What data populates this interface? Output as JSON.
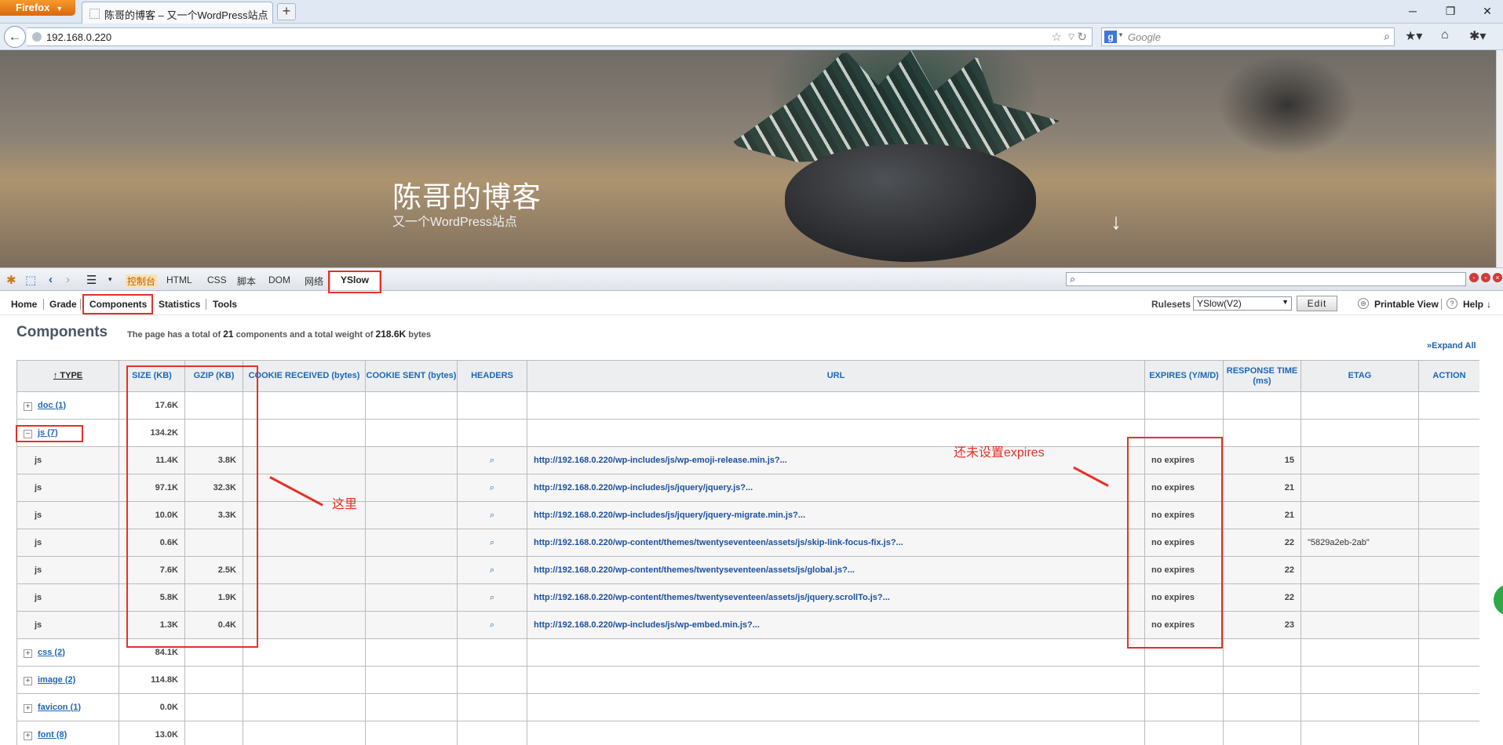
{
  "browser": {
    "app_button": "Firefox",
    "tab_title": "陈哥的博客 – 又一个WordPress站点",
    "address": "192.168.0.220",
    "search_placeholder": "Google"
  },
  "hero": {
    "site_title": "陈哥的博客",
    "site_desc": "又一个WordPress站点"
  },
  "firebug": {
    "tabs": [
      "控制台",
      "HTML",
      "CSS",
      "脚本",
      "DOM",
      "网络"
    ],
    "active_tab": "YSlow"
  },
  "yslow_menu": {
    "items": [
      "Home",
      "Grade",
      "Components",
      "Statistics",
      "Tools"
    ],
    "rulesets_label": "Rulesets",
    "ruleset_value": "YSlow(V2)",
    "edit_label": "Edit",
    "printable_label": "Printable View",
    "help_label": "Help"
  },
  "components": {
    "title": "Components",
    "summary_pre": "The page has a total of",
    "total_count": "21",
    "summary_mid": "components and a total weight of",
    "total_weight": "218.6K",
    "summary_post": "bytes",
    "expand_all": "»Expand All"
  },
  "table": {
    "columns": [
      "↑ TYPE",
      "SIZE (KB)",
      "GZIP (KB)",
      "COOKIE RECEIVED (bytes)",
      "COOKIE SENT (bytes)",
      "HEADERS",
      "URL",
      "EXPIRES (Y/M/D)",
      "RESPONSE TIME (ms)",
      "ETAG",
      "ACTION"
    ],
    "rows": [
      {
        "kind": "group",
        "type": "doc (1)",
        "expanded": false,
        "size": "17.6K"
      },
      {
        "kind": "group",
        "type": "js (7)",
        "expanded": true,
        "size": "134.2K"
      },
      {
        "kind": "item",
        "type": "js",
        "size": "11.4K",
        "gzip": "3.8K",
        "url": "http://192.168.0.220/wp-includes/js/wp-emoji-release.min.js?...",
        "expires": "no expires",
        "time": "15",
        "etag": ""
      },
      {
        "kind": "item",
        "type": "js",
        "size": "97.1K",
        "gzip": "32.3K",
        "url": "http://192.168.0.220/wp-includes/js/jquery/jquery.js?...",
        "expires": "no expires",
        "time": "21",
        "etag": ""
      },
      {
        "kind": "item",
        "type": "js",
        "size": "10.0K",
        "gzip": "3.3K",
        "url": "http://192.168.0.220/wp-includes/js/jquery/jquery-migrate.min.js?...",
        "expires": "no expires",
        "time": "21",
        "etag": ""
      },
      {
        "kind": "item",
        "type": "js",
        "size": "0.6K",
        "gzip": "",
        "url": "http://192.168.0.220/wp-content/themes/twentyseventeen/assets/js/skip-link-focus-fix.js?...",
        "expires": "no expires",
        "time": "22",
        "etag": "\"5829a2eb-2ab\""
      },
      {
        "kind": "item",
        "type": "js",
        "size": "7.6K",
        "gzip": "2.5K",
        "url": "http://192.168.0.220/wp-content/themes/twentyseventeen/assets/js/global.js?...",
        "expires": "no expires",
        "time": "22",
        "etag": ""
      },
      {
        "kind": "item",
        "type": "js",
        "size": "5.8K",
        "gzip": "1.9K",
        "url": "http://192.168.0.220/wp-content/themes/twentyseventeen/assets/js/jquery.scrollTo.js?...",
        "expires": "no expires",
        "time": "22",
        "etag": ""
      },
      {
        "kind": "item",
        "type": "js",
        "size": "1.3K",
        "gzip": "0.4K",
        "url": "http://192.168.0.220/wp-includes/js/wp-embed.min.js?...",
        "expires": "no expires",
        "time": "23",
        "etag": ""
      },
      {
        "kind": "group",
        "type": "css (2)",
        "expanded": false,
        "size": "84.1K"
      },
      {
        "kind": "group",
        "type": "image (2)",
        "expanded": false,
        "size": "114.8K"
      },
      {
        "kind": "group",
        "type": "favicon (1)",
        "expanded": false,
        "size": "0.0K"
      },
      {
        "kind": "group",
        "type": "font (8)",
        "expanded": false,
        "size": "13.0K"
      }
    ]
  },
  "annotations": {
    "here_label": "这里",
    "expires_label": "还未设置expires",
    "annotation_color": "#e63027"
  },
  "icons": [
    "back-arrow-icon",
    "globe-icon",
    "star-icon",
    "reload-icon",
    "search-icon",
    "bookmarks-icon",
    "home-icon",
    "firebug-icon",
    "inspect-icon",
    "expand-icon",
    "collapse-icon",
    "magnifier-icon",
    "down-arrow-icon",
    "help-icon"
  ]
}
